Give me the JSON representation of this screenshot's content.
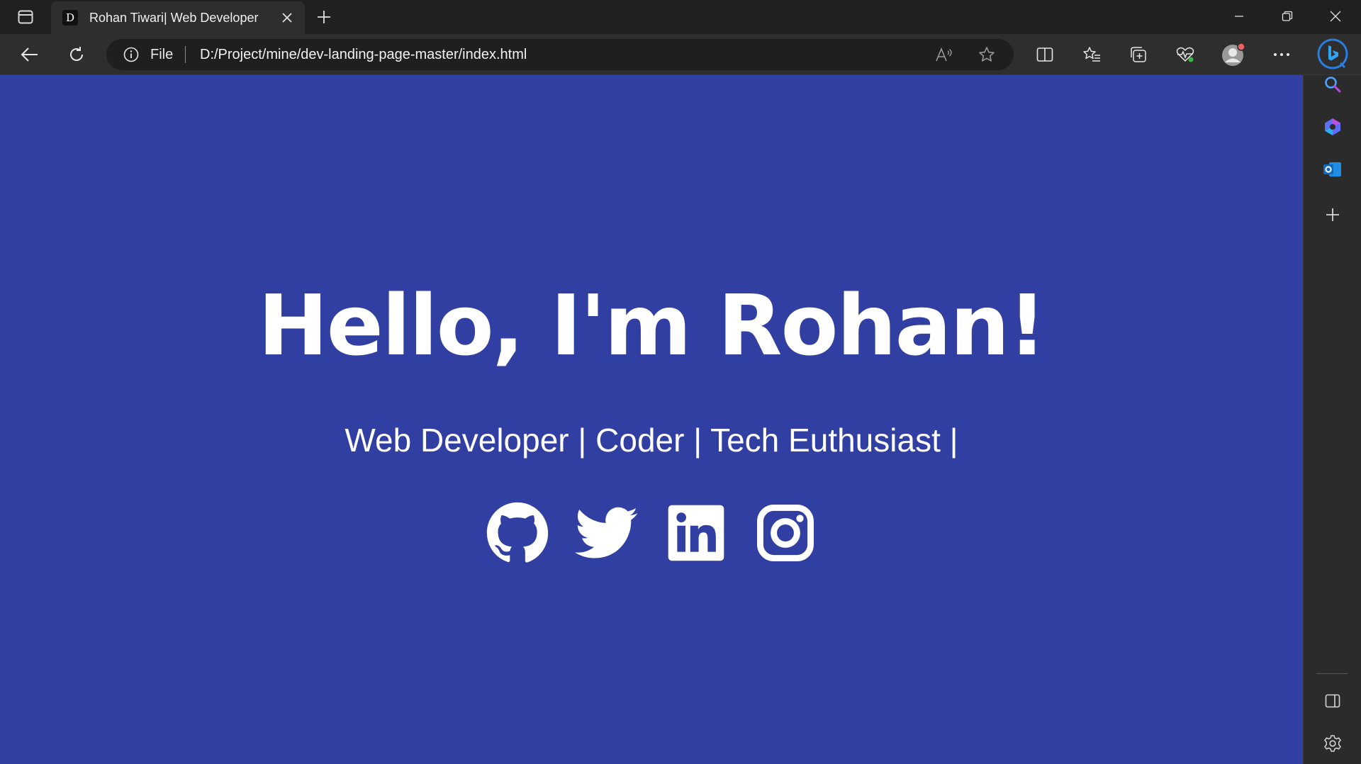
{
  "browser": {
    "tab": {
      "favicon_letter": "D",
      "title": "Rohan Tiwari| Web Developer"
    },
    "address": {
      "scheme_label": "File",
      "url": "D:/Project/mine/dev-landing-page-master/index.html"
    },
    "colors": {
      "chrome_dark": "#202020",
      "toolbar": "#2e2e2e",
      "icon": "#d6d6d6"
    }
  },
  "page": {
    "title": "Hello, I'm Rohan!",
    "subtitle": "Web Developer | Coder | Tech Euthusiast |",
    "background": "#303fa1",
    "socials": [
      {
        "name": "github-icon"
      },
      {
        "name": "twitter-icon"
      },
      {
        "name": "linkedin-icon"
      },
      {
        "name": "instagram-icon"
      }
    ]
  }
}
